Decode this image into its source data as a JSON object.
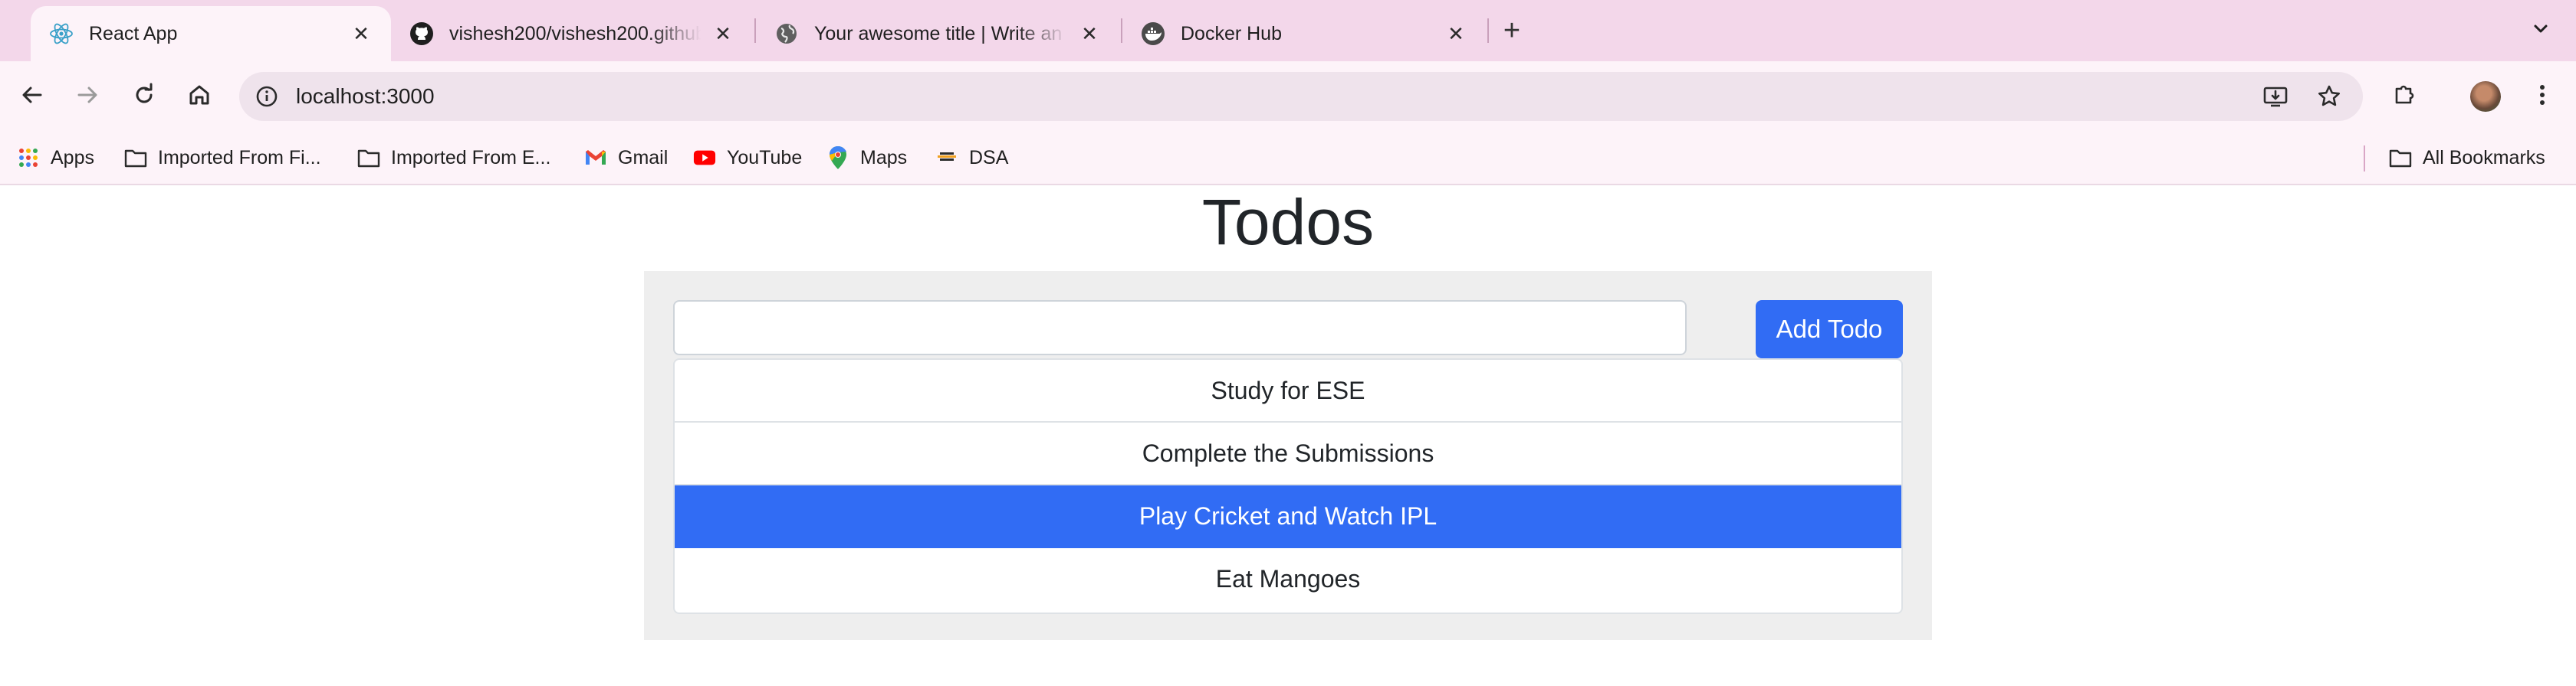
{
  "browser": {
    "tabs": [
      {
        "title": "React App",
        "favicon": "react-icon",
        "active": true
      },
      {
        "title": "vishesh200/vishesh200.github.io",
        "favicon": "github-icon",
        "active": false
      },
      {
        "title": "Your awesome title | Write an awesome description",
        "favicon": "globe-icon",
        "active": false
      },
      {
        "title": "Docker Hub",
        "favicon": "docker-icon",
        "active": false
      }
    ],
    "close_glyph": "✕",
    "new_tab_glyph": "+",
    "url": "localhost:3000",
    "bookmarks": [
      {
        "label": "Apps",
        "icon": "apps-grid-icon"
      },
      {
        "label": "Imported From Fi...",
        "icon": "folder-icon"
      },
      {
        "label": "Imported From E...",
        "icon": "folder-icon"
      },
      {
        "label": "Gmail",
        "icon": "gmail-icon"
      },
      {
        "label": "YouTube",
        "icon": "youtube-icon"
      },
      {
        "label": "Maps",
        "icon": "maps-icon"
      },
      {
        "label": "DSA",
        "icon": "dsa-icon"
      }
    ],
    "all_bookmarks": "All Bookmarks",
    "colors": {
      "tab_strip": "#f3d7ea",
      "toolbar": "#fdf3f9",
      "omnibox": "#efe3ec"
    }
  },
  "app": {
    "title": "Todos",
    "input_value": "",
    "add_button": "Add Todo",
    "todos": [
      {
        "text": "Study for ESE",
        "active": false
      },
      {
        "text": "Complete the Submissions",
        "active": false
      },
      {
        "text": "Play Cricket and Watch IPL",
        "active": true
      },
      {
        "text": "Eat Mangoes",
        "active": false
      }
    ],
    "colors": {
      "primary": "#316cf4",
      "panel": "#eeeeee"
    }
  }
}
